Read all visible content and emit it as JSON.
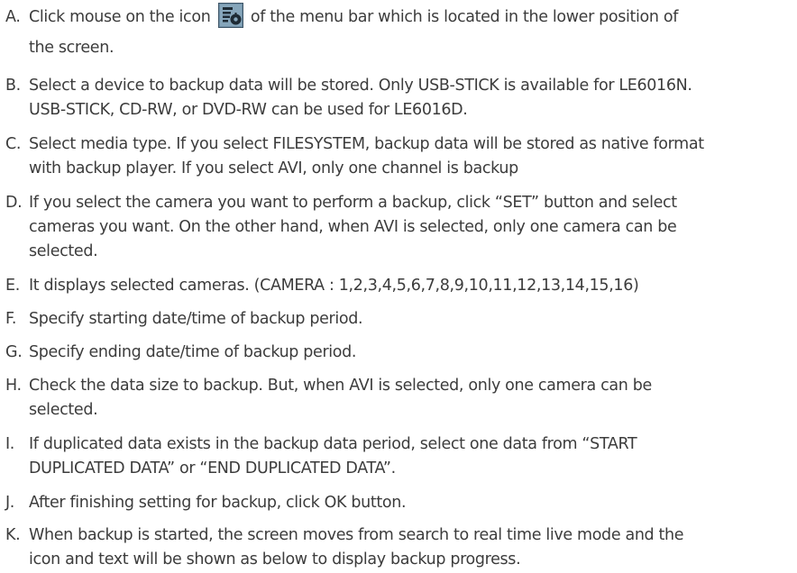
{
  "items": [
    {
      "letter": "A.",
      "lines": [
        "Click mouse on the icon",
        "of the menu bar which is located in the lower position of",
        "the screen."
      ],
      "icon": "backup-menu-icon"
    },
    {
      "letter": "B.",
      "lines": [
        "Select a device to backup data will be stored. Only USB-STICK is available for LE6016N.",
        "USB-STICK, CD-RW, or DVD-RW can be used for LE6016D."
      ]
    },
    {
      "letter": "C.",
      "lines": [
        "Select media type. If you select FILESYSTEM, backup data will be stored as native format",
        "with backup player. If you select AVI, only one channel is backup"
      ]
    },
    {
      "letter": "D.",
      "lines": [
        "If you select the camera you want to perform a backup, click “SET” button and select",
        "cameras you want. On the other hand, when AVI is selected, only one camera can be",
        "selected."
      ]
    },
    {
      "letter": "E.",
      "lines": [
        "It displays selected cameras. (CAMERA : 1,2,3,4,5,6,7,8,9,10,11,12,13,14,15,16)"
      ]
    },
    {
      "letter": "F.",
      "lines": [
        "Specify starting date/time of backup period."
      ]
    },
    {
      "letter": "G.",
      "lines": [
        "Specify ending date/time of backup period."
      ]
    },
    {
      "letter": "H.",
      "lines": [
        "Check the data size to backup. But, when AVI is selected, only one camera can be",
        "selected."
      ]
    },
    {
      "letter": "I.",
      "lines": [
        "If duplicated data exists in the backup data period, select one data from “START",
        "DUPLICATED DATA” or “END DUPLICATED DATA”."
      ]
    },
    {
      "letter": "J.",
      "lines": [
        "After finishing setting for backup, click OK button."
      ]
    },
    {
      "letter": "K.",
      "lines": [
        "When backup is started, the screen moves from search to real time live mode and the",
        "icon and text will be shown as below to display backup progress."
      ]
    }
  ]
}
